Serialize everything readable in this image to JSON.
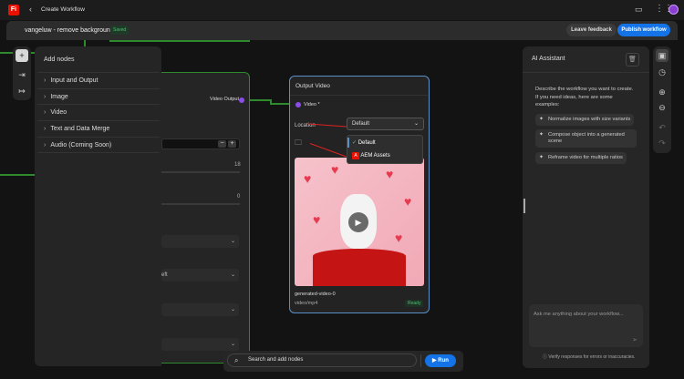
{
  "topbar": {
    "logo": "Fi",
    "title": "Create Workflow"
  },
  "header": {
    "workflow_name": "vangeluw - remove background",
    "status": "Saved",
    "feedback_label": "Leave feedback",
    "publish_label": "Publish workflow"
  },
  "add_nodes": {
    "title": "Add nodes",
    "categories": [
      "Input and Output",
      "Image",
      "Video",
      "Text and Data Merge",
      "Audio (Coming Soon)"
    ]
  },
  "bg_node": {
    "output_label": "Video Output",
    "value1": "18",
    "value2": "0",
    "dropdown_partial": "eft"
  },
  "output_node": {
    "title": "Output Video",
    "input_label": "Video *",
    "location_label": "Location",
    "location_value": "Default",
    "options": [
      "Default",
      "AEM Assets"
    ],
    "file_name": "generated-video-0",
    "file_type": "video/mp4",
    "status": "Ready"
  },
  "ai": {
    "title": "AI Assistant",
    "intro": "Describe the workflow you want to create. If you need ideas, here are some examples:",
    "examples": [
      "Normalize images with size variants",
      "Compose object into a generated scene",
      "Reframe video for multiple ratios"
    ],
    "placeholder": "Ask me anything about your workflow...",
    "disclaimer": "Verify responses for errors or inaccuracies."
  },
  "bottom": {
    "search_placeholder": "Search and add nodes",
    "run_label": "Run"
  },
  "colors": {
    "accent": "#1473e6",
    "node_border": "#2d8a2d",
    "selected_node": "#5a8fc7",
    "logo": "#eb1000"
  }
}
